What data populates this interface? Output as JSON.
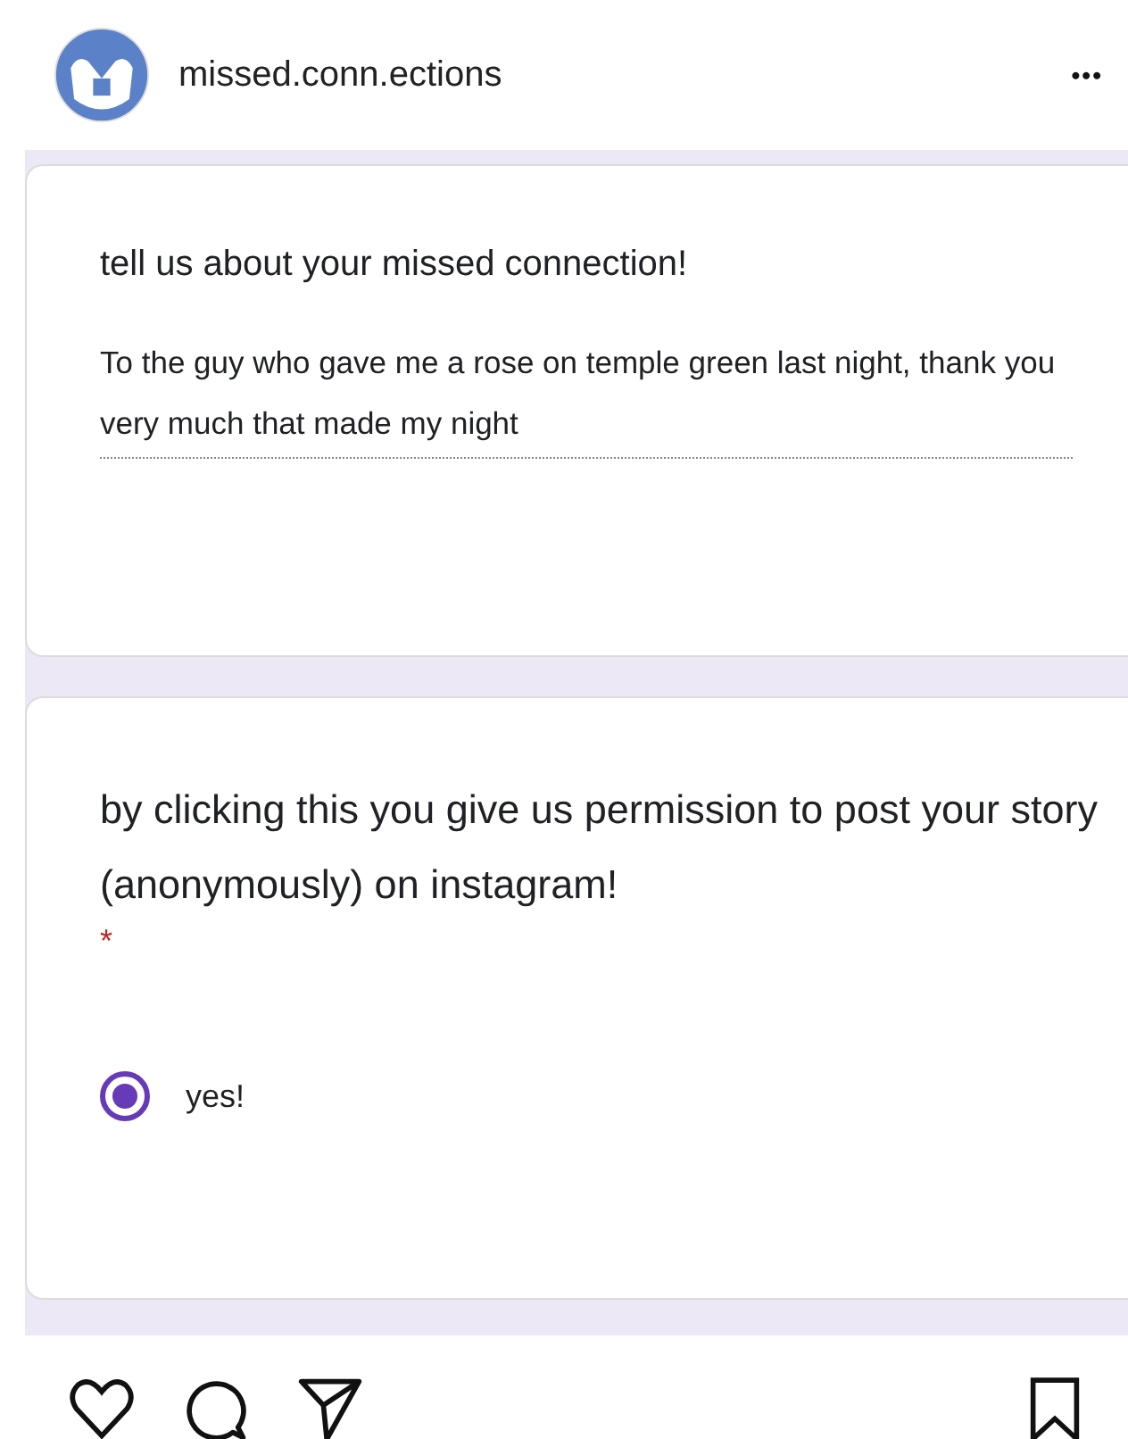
{
  "post_header": {
    "username": "missed.conn.ections",
    "more": "•••"
  },
  "form_cards": [
    {
      "kind": "text",
      "question": "tell us about your missed connection!",
      "answer": "To the guy who gave me a rose on temple green last night, thank you very much that made my night"
    },
    {
      "kind": "choice",
      "question": "by clicking this you give us permission to post your story (anonymously) on instagram!",
      "required": "*",
      "options": [
        {
          "label": "yes!",
          "selected": true
        }
      ]
    }
  ]
}
